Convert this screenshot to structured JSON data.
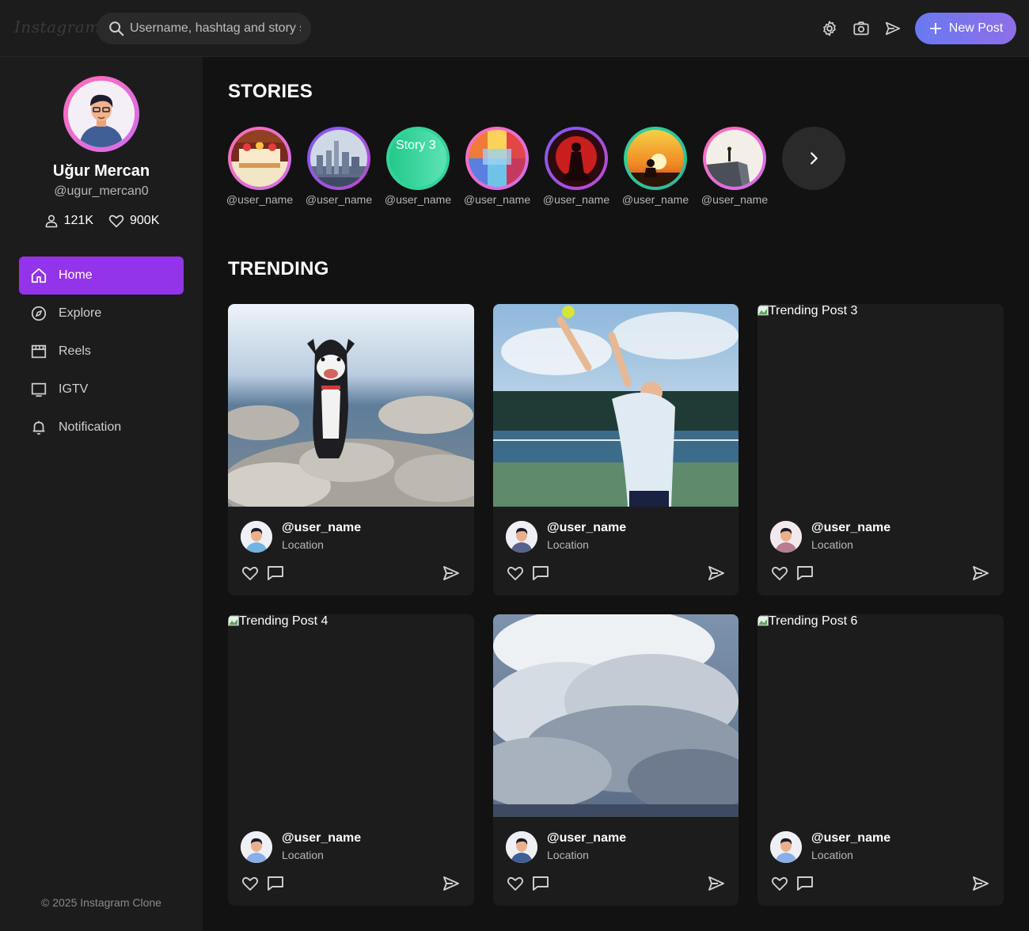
{
  "header": {
    "logo": "Instagram",
    "search_placeholder": "Username, hashtag and story search",
    "new_post_label": "New Post"
  },
  "profile": {
    "name": "Uğur Mercan",
    "handle": "@ugur_mercan0",
    "followers": "121K",
    "likes": "900K"
  },
  "nav": [
    {
      "label": "Home",
      "icon": "home-icon",
      "active": true
    },
    {
      "label": "Explore",
      "icon": "compass-icon"
    },
    {
      "label": "Reels",
      "icon": "clapperboard-icon"
    },
    {
      "label": "IGTV",
      "icon": "tv-icon"
    },
    {
      "label": "Notification",
      "icon": "bell-icon"
    }
  ],
  "footer": "© 2025 Instagram Clone",
  "stories_title": "STORIES",
  "stories": [
    {
      "user": "@user_name",
      "ring": "pink",
      "scene": "cake"
    },
    {
      "user": "@user_name",
      "ring": "purple",
      "scene": "city"
    },
    {
      "user": "@user_name",
      "ring": "green",
      "scene": "broken",
      "alt": "Story 3"
    },
    {
      "user": "@user_name",
      "ring": "pink",
      "scene": "abstract"
    },
    {
      "user": "@user_name",
      "ring": "purple",
      "scene": "dancer"
    },
    {
      "user": "@user_name",
      "ring": "green",
      "scene": "sunset"
    },
    {
      "user": "@user_name",
      "ring": "pink",
      "scene": "cliff"
    }
  ],
  "trending_title": "TRENDING",
  "posts": [
    {
      "user": "@user_name",
      "location": "Location",
      "scene": "dog"
    },
    {
      "user": "@user_name",
      "location": "Location",
      "scene": "tennis"
    },
    {
      "user": "@user_name",
      "location": "Location",
      "scene": "broken",
      "alt": "Trending Post 3"
    },
    {
      "user": "@user_name",
      "location": "Location",
      "scene": "broken",
      "alt": "Trending Post 4"
    },
    {
      "user": "@user_name",
      "location": "Location",
      "scene": "clouds"
    },
    {
      "user": "@user_name",
      "location": "Location",
      "scene": "broken",
      "alt": "Trending Post 6"
    }
  ],
  "colors": {
    "accent": "#9333ea",
    "new_post_gradient_start": "#6a79f0",
    "new_post_gradient_end": "#8e6fe8",
    "ring_pink": "#ff6fb5",
    "ring_purple": "#7b5cf0",
    "ring_green": "#34d399"
  }
}
